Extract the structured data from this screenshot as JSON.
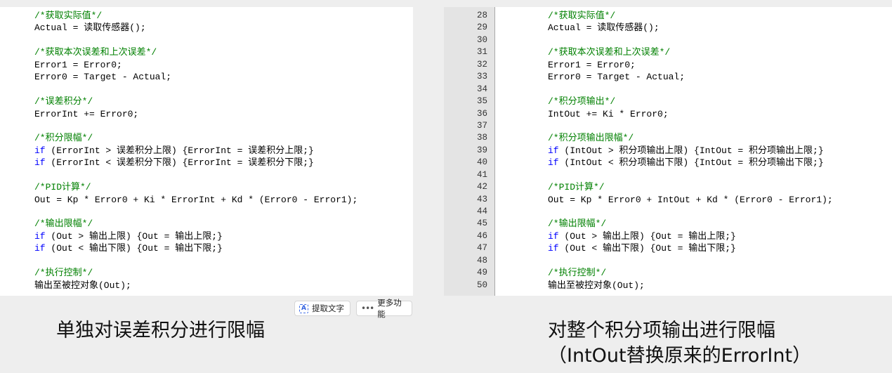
{
  "left_panel": {
    "lines": [
      {
        "type": "comment",
        "text": "/*获取实际值*/"
      },
      {
        "type": "code",
        "text": "Actual = 读取传感器();"
      },
      {
        "type": "blank",
        "text": ""
      },
      {
        "type": "comment",
        "text": "/*获取本次误差和上次误差*/"
      },
      {
        "type": "code",
        "text": "Error1 = Error0;"
      },
      {
        "type": "code",
        "text": "Error0 = Target - Actual;"
      },
      {
        "type": "blank",
        "text": ""
      },
      {
        "type": "comment",
        "text": "/*误差积分*/"
      },
      {
        "type": "code",
        "text": "ErrorInt += Error0;"
      },
      {
        "type": "blank",
        "text": ""
      },
      {
        "type": "comment",
        "text": "/*积分限幅*/"
      },
      {
        "type": "if",
        "keyword": "if",
        "text": " (ErrorInt > 误差积分上限) {ErrorInt = 误差积分上限;}"
      },
      {
        "type": "if",
        "keyword": "if",
        "text": " (ErrorInt < 误差积分下限) {ErrorInt = 误差积分下限;}"
      },
      {
        "type": "blank",
        "text": ""
      },
      {
        "type": "comment",
        "text": "/*PID计算*/"
      },
      {
        "type": "code",
        "text": "Out = Kp * Error0 + Ki * ErrorInt + Kd * (Error0 - Error1);"
      },
      {
        "type": "blank",
        "text": ""
      },
      {
        "type": "comment",
        "text": "/*输出限幅*/"
      },
      {
        "type": "if",
        "keyword": "if",
        "text": " (Out > 输出上限) {Out = 输出上限;}"
      },
      {
        "type": "if",
        "keyword": "if",
        "text": " (Out < 输出下限) {Out = 输出下限;}"
      },
      {
        "type": "blank",
        "text": ""
      },
      {
        "type": "comment",
        "text": "/*执行控制*/"
      },
      {
        "type": "code",
        "text": "输出至被控对象(Out);"
      }
    ]
  },
  "right_panel": {
    "line_numbers": [
      "28",
      "29",
      "30",
      "31",
      "32",
      "33",
      "34",
      "35",
      "36",
      "37",
      "38",
      "39",
      "40",
      "41",
      "42",
      "43",
      "44",
      "45",
      "46",
      "47",
      "48",
      "49",
      "50"
    ],
    "lines": [
      {
        "type": "comment",
        "text": "/*获取实际值*/"
      },
      {
        "type": "code",
        "text": "Actual = 读取传感器();"
      },
      {
        "type": "blank",
        "text": ""
      },
      {
        "type": "comment",
        "text": "/*获取本次误差和上次误差*/"
      },
      {
        "type": "code",
        "text": "Error1 = Error0;"
      },
      {
        "type": "code",
        "text": "Error0 = Target - Actual;"
      },
      {
        "type": "blank",
        "text": ""
      },
      {
        "type": "comment",
        "text": "/*积分项输出*/"
      },
      {
        "type": "code",
        "text": "IntOut += Ki * Error0;"
      },
      {
        "type": "blank",
        "text": ""
      },
      {
        "type": "comment",
        "text": "/*积分项输出限幅*/"
      },
      {
        "type": "if",
        "keyword": "if",
        "text": " (IntOut > 积分项输出上限) {IntOut = 积分项输出上限;}"
      },
      {
        "type": "if",
        "keyword": "if",
        "text": " (IntOut < 积分项输出下限) {IntOut = 积分项输出下限;}"
      },
      {
        "type": "blank",
        "text": ""
      },
      {
        "type": "comment",
        "text": "/*PID计算*/"
      },
      {
        "type": "code",
        "text": "Out = Kp * Error0 + IntOut + Kd * (Error0 - Error1);"
      },
      {
        "type": "blank",
        "text": ""
      },
      {
        "type": "comment",
        "text": "/*输出限幅*/"
      },
      {
        "type": "if",
        "keyword": "if",
        "text": " (Out > 输出上限) {Out = 输出上限;}"
      },
      {
        "type": "if",
        "keyword": "if",
        "text": " (Out < 输出下限) {Out = 输出下限;}"
      },
      {
        "type": "blank",
        "text": ""
      },
      {
        "type": "comment",
        "text": "/*执行控制*/"
      },
      {
        "type": "code",
        "text": "输出至被控对象(Out);"
      }
    ]
  },
  "toolbar": {
    "extract_text_label": "提取文字",
    "more_functions_label": "更多功能"
  },
  "captions": {
    "left": "单独对误差积分进行限幅",
    "right_line1": "对整个积分项输出进行限幅",
    "right_line2": "（IntOut替换原来的ErrorInt）"
  },
  "colors": {
    "comment": "#008000",
    "keyword": "#0000ff",
    "code": "#000000",
    "gutter": "#e4e4e4"
  }
}
